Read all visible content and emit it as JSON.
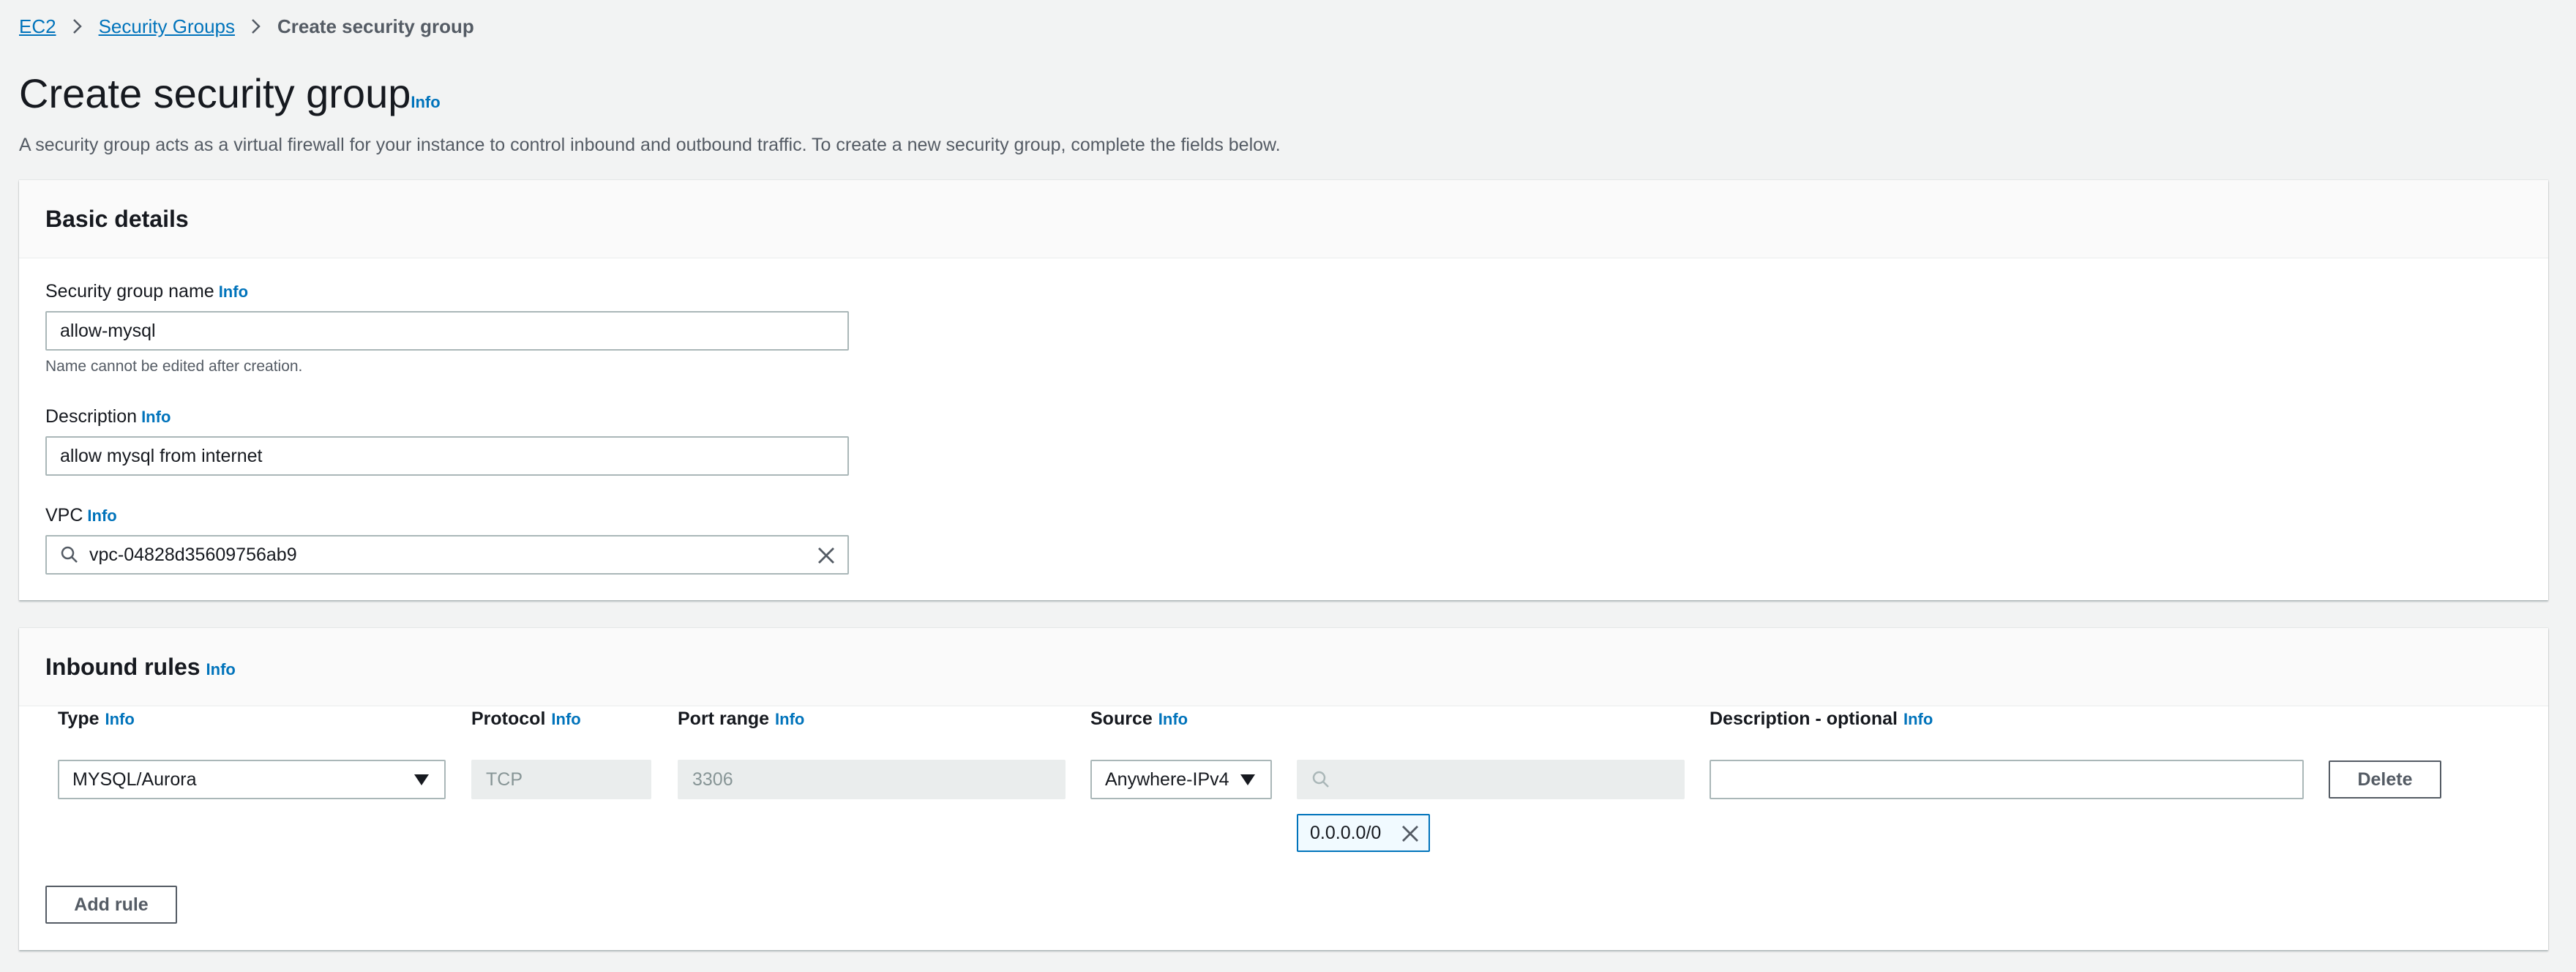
{
  "breadcrumb": {
    "items": [
      {
        "label": "EC2"
      },
      {
        "label": "Security Groups"
      }
    ],
    "current": "Create security group"
  },
  "header": {
    "title": "Create security group",
    "info": "Info",
    "description": "A security group acts as a virtual firewall for your instance to control inbound and outbound traffic. To create a new security group, complete the fields below."
  },
  "basic_details": {
    "title": "Basic details",
    "name_label": "Security group name",
    "name_info": "Info",
    "name_value": "allow-mysql",
    "name_hint": "Name cannot be edited after creation.",
    "description_label": "Description",
    "description_info": "Info",
    "description_value": "allow mysql from internet",
    "vpc_label": "VPC",
    "vpc_info": "Info",
    "vpc_value": "vpc-04828d35609756ab9"
  },
  "inbound_rules": {
    "title": "Inbound rules",
    "title_info": "Info",
    "columns": {
      "type": "Type",
      "protocol": "Protocol",
      "port_range": "Port range",
      "source": "Source",
      "description": "Description - optional",
      "info": "Info"
    },
    "rules": [
      {
        "type": "MYSQL/Aurora",
        "protocol": "TCP",
        "port_range": "3306",
        "source_type": "Anywhere-IPv4",
        "source_search": "",
        "source_token": "0.0.0.0/0",
        "description": ""
      }
    ],
    "delete_label": "Delete",
    "add_rule_label": "Add rule"
  },
  "colors": {
    "link": "#0073bb",
    "page_bg": "#f2f3f3",
    "panel_header_bg": "#fafafa",
    "disabled_bg": "#eaeded"
  }
}
